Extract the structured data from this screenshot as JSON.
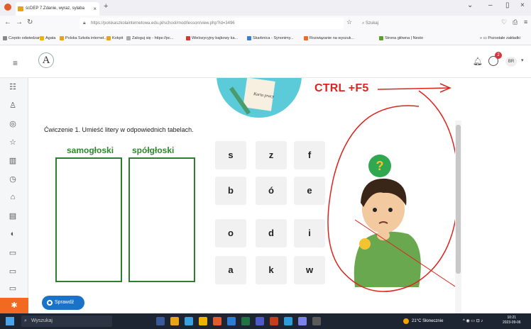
{
  "browser": {
    "tab_title": "ścDEP 7.Zdanie, wyraz, sylaba",
    "url": "https://polskaszkolainternetowa.edu.pl/school/mod/lesson/view.php?id=3496",
    "search_placeholder": "Szukaj",
    "bookmarks": [
      "Często odwiedzane",
      "Agata",
      "Polska Szkoła internet...",
      "Kokpit",
      "Zaloguj się - https://pc...",
      "Wielozycyjny bajkowy ka...",
      "Skarbnica - Synonimy...",
      "Rozwiązanie na wyszuk...",
      "Strona główna | Nesto"
    ],
    "bookmarks_other": "Pozostałe zakładki"
  },
  "header": {
    "logo_letter": "A",
    "notification_count": "2",
    "user_initials": "BR"
  },
  "exercise": {
    "instruction": "Ćwiczenie 1. Umieść litery w odpowiednich tabelach.",
    "column_left": "samogłoski",
    "column_right": "spółgłoski",
    "tiles": [
      "s",
      "z",
      "f",
      "b",
      "ó",
      "e",
      "o",
      "d",
      "i",
      "a",
      "k",
      "w"
    ],
    "check_button": "Sprawdź",
    "card_caption": "Karta pracy"
  },
  "annotation": {
    "text": "CTRL +F5",
    "color": "#e0231c"
  },
  "taskbar": {
    "search_label": "Wyszukaj",
    "weather": "21°C  Słonecznie",
    "time": "10:21",
    "date": "2023-09-06"
  },
  "colors": {
    "accent_green": "#2f7d2f",
    "button_blue": "#1a73c9",
    "sidebar_orange": "#f26a22"
  }
}
